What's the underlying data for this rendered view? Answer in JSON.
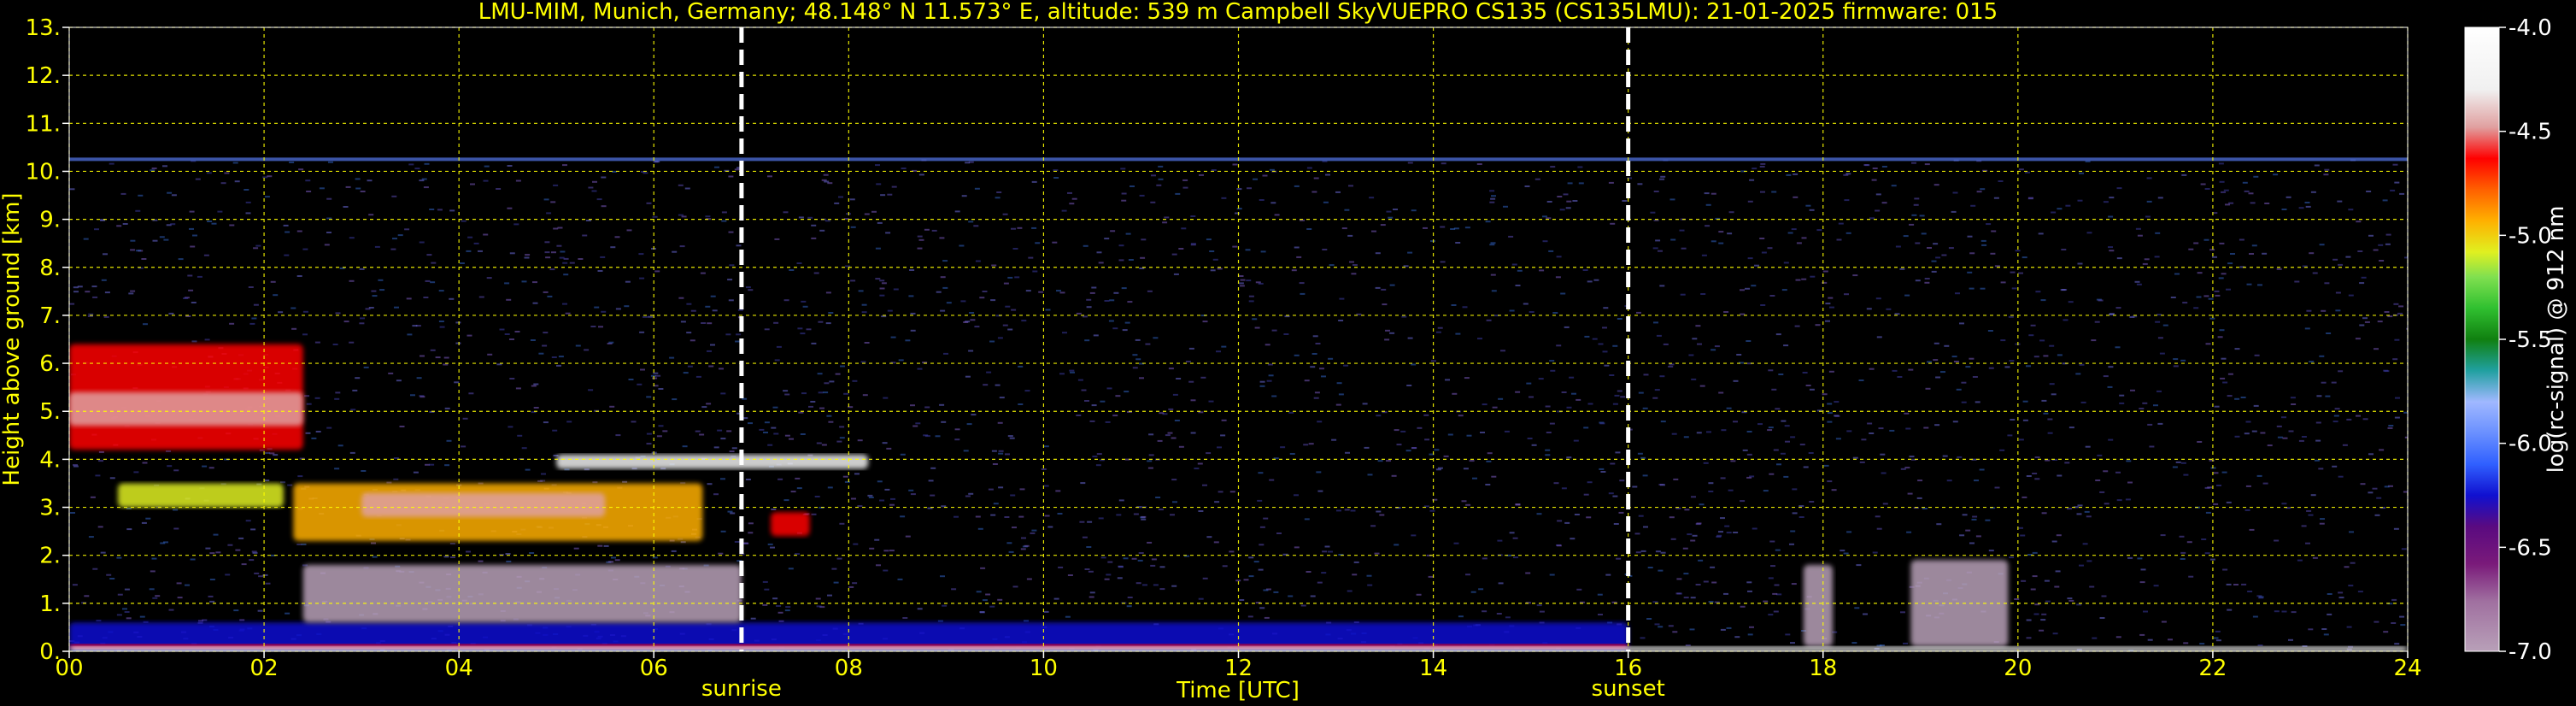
{
  "chart_data": {
    "type": "heatmap",
    "title": "LMU-MIM, Munich, Germany; 48.148° N 11.573° E, altitude: 539 m    Campbell SkyVUEPRO CS135 (CS135LMU): 21-01-2025    firmware: 015",
    "xlabel": "Time [UTC]",
    "ylabel": "Height above ground [km]",
    "xlim": [
      0,
      24
    ],
    "ylim": [
      0,
      13
    ],
    "x_ticks": [
      0,
      2,
      4,
      6,
      8,
      10,
      12,
      14,
      16,
      18,
      20,
      22,
      24
    ],
    "x_tick_labels": [
      "00",
      "02",
      "04",
      "06",
      "08",
      "10",
      "12",
      "14",
      "16",
      "18",
      "20",
      "22",
      "24"
    ],
    "y_ticks": [
      0,
      1,
      2,
      3,
      4,
      5,
      6,
      7,
      8,
      9,
      10,
      11,
      12,
      13
    ],
    "y_tick_labels": [
      "0.",
      "1.",
      "2.",
      "3.",
      "4.",
      "5.",
      "6.",
      "7.",
      "8.",
      "9.",
      "10.",
      "11.",
      "12.",
      "13."
    ],
    "grid": true,
    "grid_color": "#ffff00",
    "markers": [
      {
        "label": "sunrise",
        "x": 6.9
      },
      {
        "label": "sunset",
        "x": 16.0
      }
    ],
    "colorbar": {
      "label": "log(rc-signal) @ 912 nm",
      "range": [
        -7.0,
        -4.0
      ],
      "ticks": [
        -7.0,
        -6.5,
        -6.0,
        -5.5,
        -5.0,
        -4.5,
        -4.0
      ],
      "tick_labels": [
        "-7.0",
        "-6.5",
        "-6.0",
        "-5.5",
        "-5.0",
        "-4.5",
        "-4.0"
      ]
    },
    "features": [
      {
        "x0": 0.0,
        "x1": 2.4,
        "y0": 4.2,
        "y1": 6.4,
        "level": -5.0
      },
      {
        "x0": 0.0,
        "x1": 2.4,
        "y0": 4.7,
        "y1": 5.4,
        "level": -4.6
      },
      {
        "x0": 0.5,
        "x1": 2.2,
        "y0": 3.0,
        "y1": 3.5,
        "level": -5.2
      },
      {
        "x0": 2.3,
        "x1": 6.5,
        "y0": 2.3,
        "y1": 3.5,
        "level": -5.1
      },
      {
        "x0": 3.0,
        "x1": 5.5,
        "y0": 2.8,
        "y1": 3.3,
        "level": -4.5
      },
      {
        "x0": 5.0,
        "x1": 8.2,
        "y0": 3.8,
        "y1": 4.1,
        "level": -4.3
      },
      {
        "x0": 7.2,
        "x1": 7.6,
        "y0": 2.4,
        "y1": 2.9,
        "level": -5.0
      },
      {
        "x0": 0.0,
        "x1": 16.0,
        "y0": 0.0,
        "y1": 0.6,
        "level": -6.3
      },
      {
        "x0": 0.0,
        "x1": 16.0,
        "y0": 0.05,
        "y1": 0.15,
        "level": -5.0
      },
      {
        "x0": 2.4,
        "x1": 6.9,
        "y0": 0.6,
        "y1": 1.8,
        "level": -6.8
      },
      {
        "x0": 17.8,
        "x1": 18.1,
        "y0": 0.1,
        "y1": 1.8,
        "level": -6.8
      },
      {
        "x0": 18.9,
        "x1": 19.9,
        "y0": 0.1,
        "y1": 1.9,
        "level": -6.8
      },
      {
        "x0": 0.0,
        "x1": 24.0,
        "y0": 0.0,
        "y1": 0.1,
        "level": -4.0
      }
    ]
  }
}
